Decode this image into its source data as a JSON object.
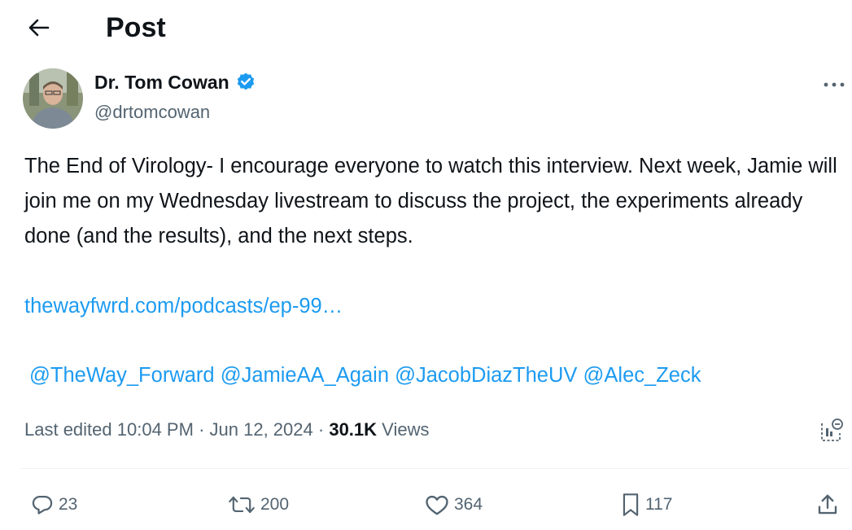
{
  "header": {
    "back_icon": "arrow-left-icon",
    "title": "Post"
  },
  "author": {
    "display_name": "Dr. Tom Cowan",
    "handle": "@drtomcowan",
    "verified_icon": "verified-badge-icon",
    "verified_color": "#1d9bf0"
  },
  "more_icon": "more-horizontal-icon",
  "tweet": {
    "text": "The End of Virology- I encourage everyone to watch this interview. Next week, Jamie will join me on my Wednesday livestream to discuss the project, the experiments already done (and the results), and the next steps.",
    "link": "thewayfwrd.com/podcasts/ep-99…",
    "mentions": [
      "@TheWay_Forward",
      "@JamieAA_Again",
      "@JacobDiazTheUV",
      "@Alec_Zeck"
    ]
  },
  "meta": {
    "edited_prefix": "Last edited",
    "time": "10:04 PM",
    "separator": "·",
    "date": "Jun 12, 2024",
    "views_count": "30.1K",
    "views_label": "Views"
  },
  "actions": {
    "reply_count": "23",
    "repost_count": "200",
    "like_count": "364",
    "bookmark_count": "117"
  },
  "colors": {
    "link": "#1d9bf0",
    "secondary_text": "#536471",
    "primary_text": "#0f1419"
  }
}
